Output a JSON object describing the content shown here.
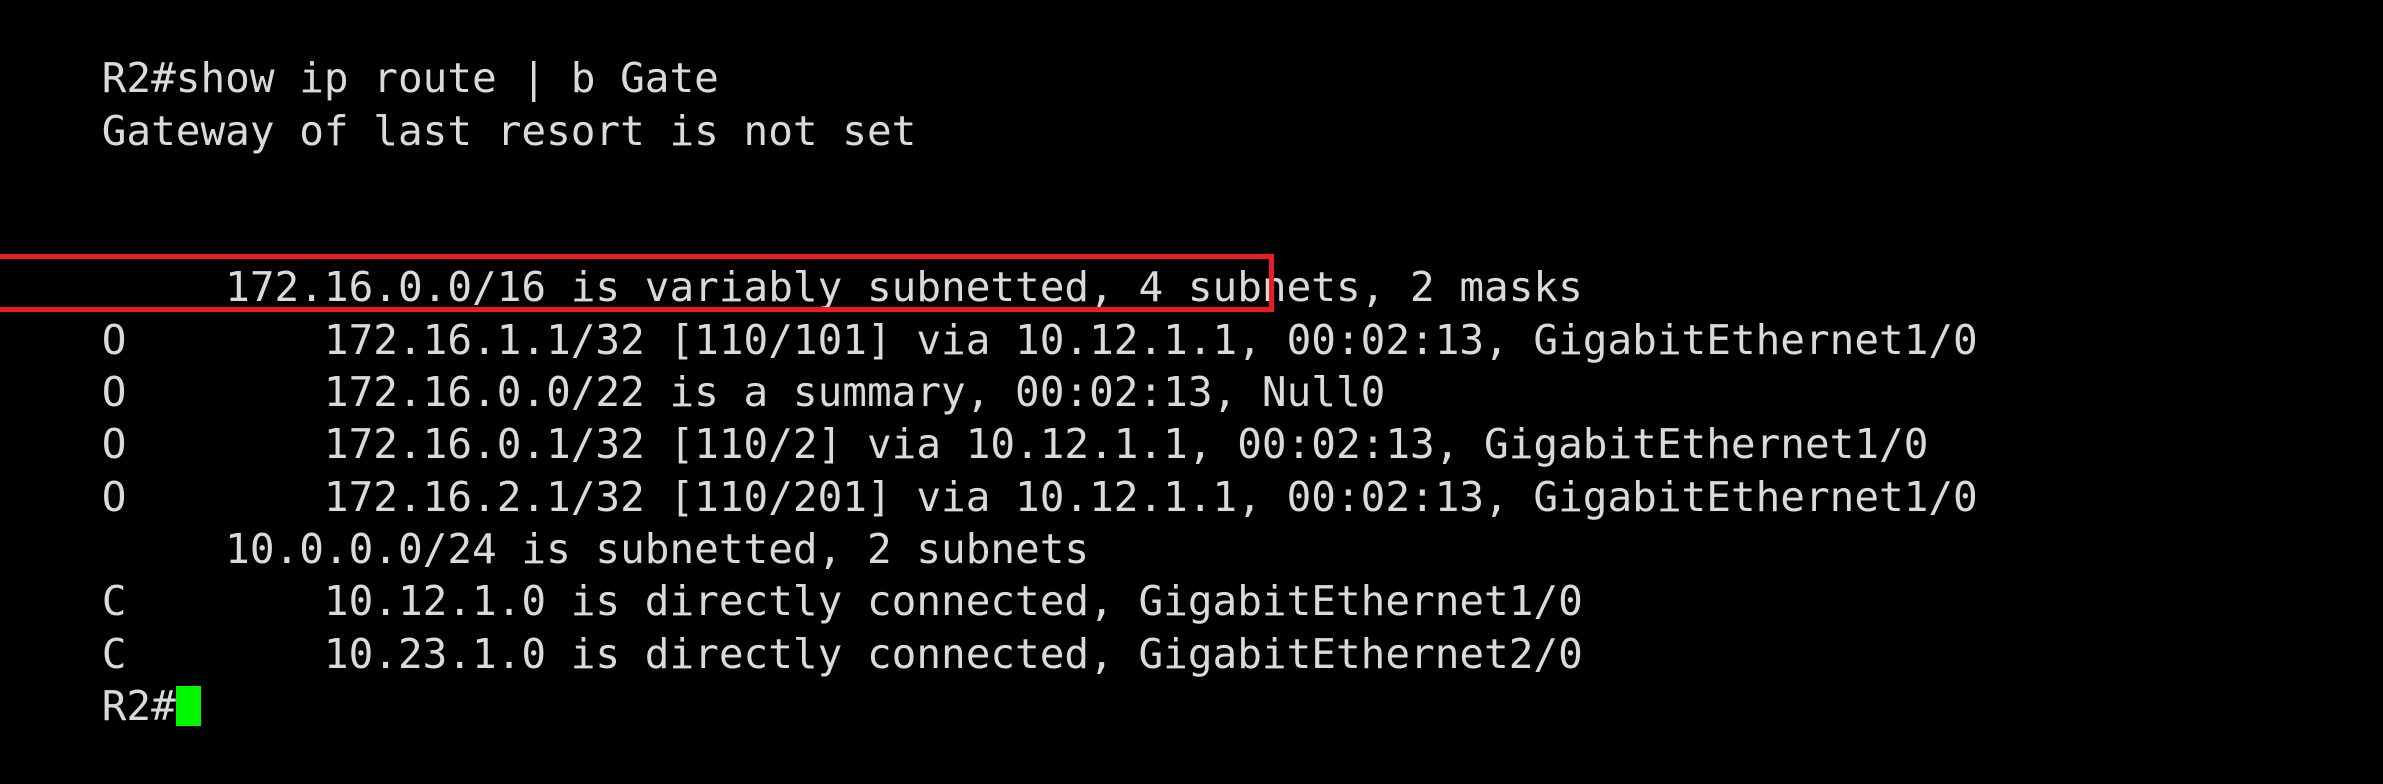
{
  "terminal": {
    "background_color": "#000000",
    "foreground_color": "#d9dadb",
    "cursor_color": "#00f700",
    "highlight_color": "#ed1c24",
    "hostname": "R2",
    "prompt": "R2#",
    "command": "show ip route | b Gate",
    "lines": [
      {
        "id": "line-command",
        "name": "command-line",
        "text": "R2#show ip route | b Gate"
      },
      {
        "id": "line-gateway",
        "name": "gateway-of-last-resort",
        "text": "Gateway of last resort is not set"
      },
      {
        "id": "line-blank-1",
        "name": "blank-line",
        "text": " "
      },
      {
        "id": "line-blank-2",
        "name": "blank-line",
        "text": " "
      },
      {
        "id": "line-parent-172",
        "name": "parent-network-172-16",
        "text": "     172.16.0.0/16 is variably subnetted, 4 subnets, 2 masks"
      },
      {
        "id": "line-route-1",
        "name": "route-ospf-172-16-1-1",
        "text": "O        172.16.1.1/32 [110/101] via 10.12.1.1, 00:02:13, GigabitEthernet1/0"
      },
      {
        "id": "line-route-2",
        "name": "route-ospf-summary-172-16-0-0",
        "text": "O        172.16.0.0/22 is a summary, 00:02:13, Null0"
      },
      {
        "id": "line-route-3",
        "name": "route-ospf-172-16-0-1",
        "text": "O        172.16.0.1/32 [110/2] via 10.12.1.1, 00:02:13, GigabitEthernet1/0"
      },
      {
        "id": "line-route-4",
        "name": "route-ospf-172-16-2-1",
        "text": "O        172.16.2.1/32 [110/201] via 10.12.1.1, 00:02:13, GigabitEthernet1/0"
      },
      {
        "id": "line-parent-10",
        "name": "parent-network-10-0-0-0",
        "text": "     10.0.0.0/24 is subnetted, 2 subnets"
      },
      {
        "id": "line-route-5",
        "name": "route-connected-10-12-1-0",
        "text": "C        10.12.1.0 is directly connected, GigabitEthernet1/0"
      },
      {
        "id": "line-route-6",
        "name": "route-connected-10-23-1-0",
        "text": "C        10.23.1.0 is directly connected, GigabitEthernet2/0"
      }
    ],
    "prompt_line": {
      "name": "prompt-line",
      "text": "R2#"
    },
    "highlighted_line_index": 6,
    "highlighted_text": "O        172.16.0.0/22 is a summary, 00:02:13, Null0"
  },
  "route_table": {
    "gateway_of_last_resort": "is not set",
    "parents": [
      {
        "network": "172.16.0.0/16",
        "description": "is variably subnetted, 4 subnets, 2 masks",
        "subnet_count": "4",
        "mask_count": "2"
      },
      {
        "network": "10.0.0.0/24",
        "description": "is subnetted, 2 subnets",
        "subnet_count": "2"
      }
    ],
    "routes": [
      {
        "code": "O",
        "prefix": "172.16.1.1/32",
        "metric": "[110/101]",
        "via": "10.12.1.1",
        "uptime": "00:02:13",
        "interface": "GigabitEthernet1/0",
        "highlighted": "false"
      },
      {
        "code": "O",
        "prefix": "172.16.0.0/22",
        "metric": "is a summary",
        "via": "",
        "uptime": "00:02:13",
        "interface": "Null0",
        "highlighted": "true"
      },
      {
        "code": "O",
        "prefix": "172.16.0.1/32",
        "metric": "[110/2]",
        "via": "10.12.1.1",
        "uptime": "00:02:13",
        "interface": "GigabitEthernet1/0",
        "highlighted": "false"
      },
      {
        "code": "O",
        "prefix": "172.16.2.1/32",
        "metric": "[110/201]",
        "via": "10.12.1.1",
        "uptime": "00:02:13",
        "interface": "GigabitEthernet1/0",
        "highlighted": "false"
      },
      {
        "code": "C",
        "prefix": "10.12.1.0",
        "metric": "is directly connected",
        "via": "",
        "uptime": "",
        "interface": "GigabitEthernet1/0",
        "highlighted": "false"
      },
      {
        "code": "C",
        "prefix": "10.23.1.0",
        "metric": "is directly connected",
        "via": "",
        "uptime": "",
        "interface": "GigabitEthernet2/0",
        "highlighted": "false"
      }
    ]
  }
}
